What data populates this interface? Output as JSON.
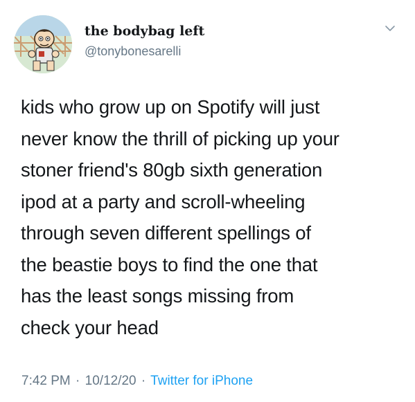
{
  "author": {
    "display_name": "the bodybag left",
    "handle": "@tonybonesarelli"
  },
  "tweet": {
    "text_lines": [
      "kids who grow up on Spotify will just",
      "never know the thrill of picking up your",
      "stoner friend's 80gb sixth generation",
      "ipod at a party and scroll-wheeling",
      "through seven different spellings of",
      "the beastie boys to find the one that",
      "has the least songs missing from",
      "check your head"
    ],
    "time": "7:42 PM",
    "date": "10/12/20",
    "source": "Twitter for iPhone",
    "separator": "·"
  },
  "icons": {
    "caret": "chevron-down-icon",
    "avatar": "cartoon-avatar"
  },
  "colors": {
    "text": "#14171a",
    "secondary": "#657786",
    "link": "#1da1f2"
  }
}
